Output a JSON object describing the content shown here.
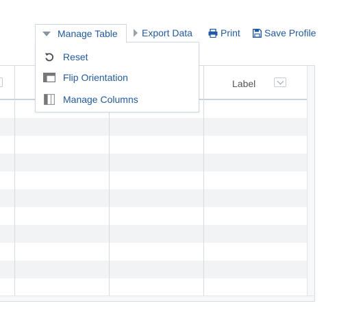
{
  "toolbar": {
    "manage_table": {
      "label": "Manage Table",
      "icon": "triangle-down-icon"
    },
    "export_data": {
      "label": "Export Data",
      "icon": "triangle-right-icon"
    },
    "print": {
      "label": "Print",
      "icon": "printer-icon"
    },
    "save_profile": {
      "label": "Save Profile",
      "icon": "floppy-disk-icon"
    }
  },
  "menu": {
    "items": [
      {
        "label": "Reset",
        "icon": "reset-icon"
      },
      {
        "label": "Flip Orientation",
        "icon": "flip-orientation-icon"
      },
      {
        "label": "Manage Columns",
        "icon": "manage-columns-icon"
      }
    ]
  },
  "grid": {
    "columns": [
      {
        "header": ""
      },
      {
        "header": ""
      },
      {
        "header": ""
      },
      {
        "header": "Label"
      }
    ],
    "row_count": 11
  },
  "colors": {
    "link": "#1f5aa6",
    "row_alt": "#f2f3f4",
    "border": "#d6dbe0",
    "header_border": "#c9d3dc"
  }
}
